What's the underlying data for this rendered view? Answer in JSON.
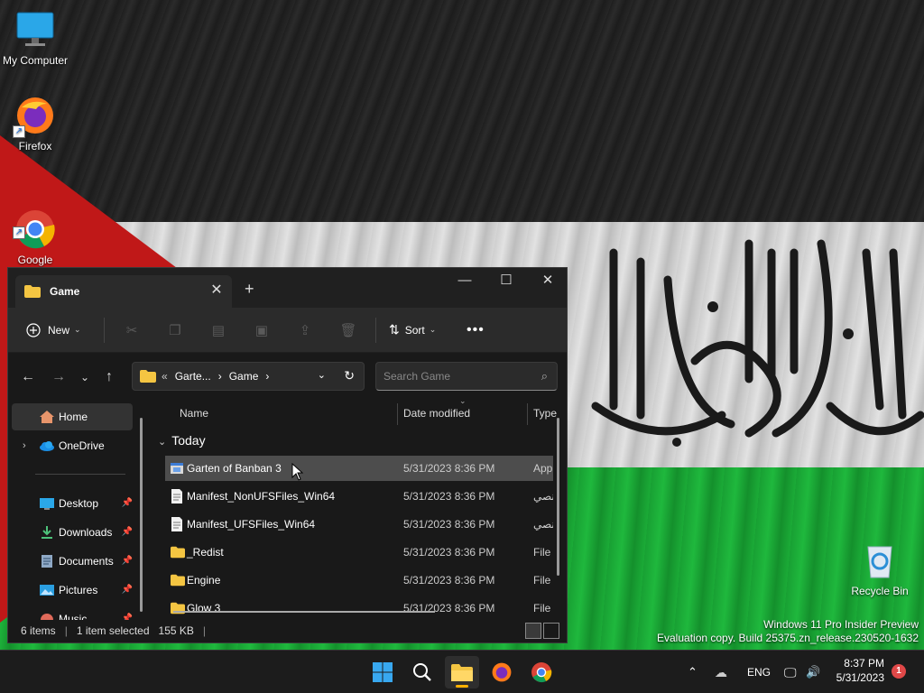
{
  "desktop": {
    "icons": [
      {
        "label": "My Computer",
        "icon": "monitor-icon"
      },
      {
        "label": "Firefox",
        "icon": "firefox-icon"
      },
      {
        "label": "Google\nChrome",
        "icon": "chrome-icon"
      },
      {
        "label": "Recycle Bin",
        "icon": "recycle-bin-icon"
      }
    ],
    "watermark": {
      "line1": "Windows 11 Pro Insider Preview",
      "line2": "Evaluation copy. Build 25375.zn_release.230520-1632"
    }
  },
  "explorer": {
    "tab_title": "Game",
    "toolbar": {
      "new_label": "New",
      "sort_label": "Sort",
      "icons": [
        "cut-icon",
        "copy-icon",
        "paste-icon",
        "rename-icon",
        "share-icon",
        "delete-icon"
      ]
    },
    "address": {
      "overflow": "«",
      "crumb1": "Garte...",
      "crumb2": "Game"
    },
    "search": {
      "placeholder": "Search Game"
    },
    "nav": {
      "home": "Home",
      "onedrive": "OneDrive",
      "desktop": "Desktop",
      "downloads": "Downloads",
      "documents": "Documents",
      "pictures": "Pictures",
      "music": "Music"
    },
    "columns": {
      "name": "Name",
      "date": "Date modified",
      "type": "Type"
    },
    "group": "Today",
    "files": [
      {
        "name": "Garten of Banban 3",
        "date": "5/31/2023 8:36 PM",
        "type": "App",
        "kind": "app"
      },
      {
        "name": "Manifest_NonUFSFiles_Win64",
        "date": "5/31/2023 8:36 PM",
        "type": "نصي",
        "kind": "file"
      },
      {
        "name": "Manifest_UFSFiles_Win64",
        "date": "5/31/2023 8:36 PM",
        "type": "نصي",
        "kind": "file"
      },
      {
        "name": "_Redist",
        "date": "5/31/2023 8:36 PM",
        "type": "File",
        "kind": "folder"
      },
      {
        "name": "Engine",
        "date": "5/31/2023 8:36 PM",
        "type": "File",
        "kind": "folder"
      },
      {
        "name": "Glow 3",
        "date": "5/31/2023 8:36 PM",
        "type": "File",
        "kind": "folder"
      }
    ],
    "status": {
      "items": "6 items",
      "selected": "1 item selected",
      "size": "155 KB"
    }
  },
  "taskbar": {
    "language": "ENG",
    "time": "8:37 PM",
    "date": "5/31/2023",
    "notification_count": "1"
  },
  "colors": {
    "accent_folder": "#f4c542",
    "selection": "#4d4d4d",
    "taskbar_active": "#ffb000"
  }
}
